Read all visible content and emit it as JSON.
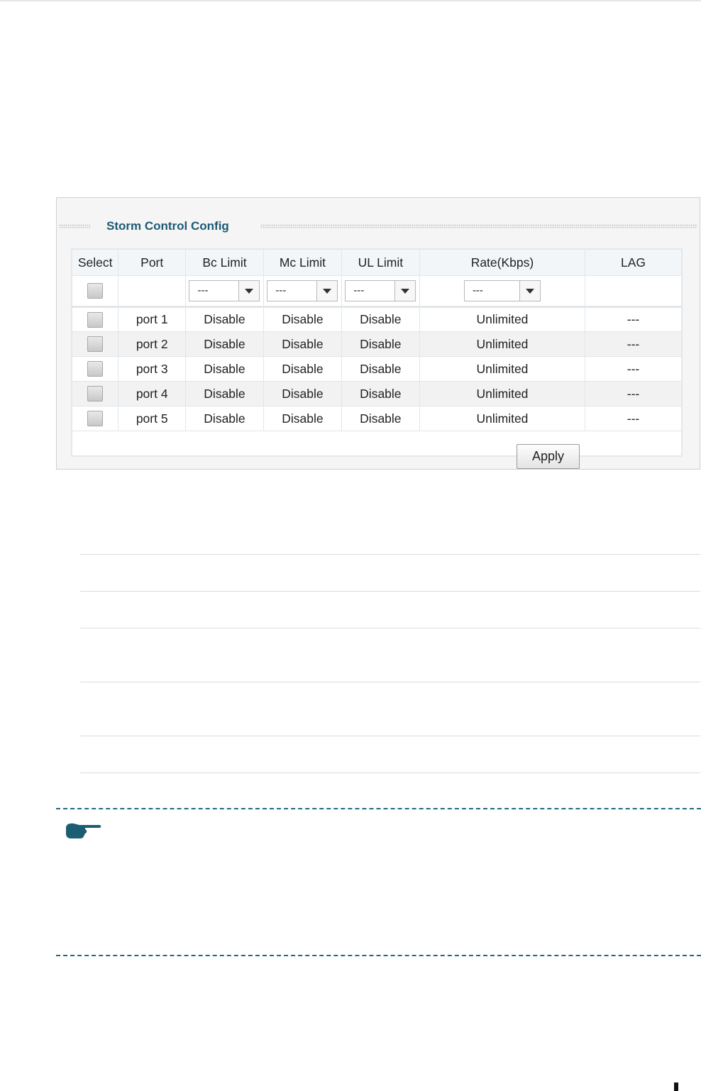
{
  "panel": {
    "title": "Storm Control Config",
    "apply_label": "Apply"
  },
  "table": {
    "headers": [
      "Select",
      "Port",
      "Bc Limit",
      "Mc Limit",
      "UL Limit",
      "Rate(Kbps)",
      "LAG"
    ],
    "filter": {
      "bc": "---",
      "mc": "---",
      "ul": "---",
      "rate": "---"
    },
    "rows": [
      {
        "port": "port 1",
        "bc": "Disable",
        "mc": "Disable",
        "ul": "Disable",
        "rate": "Unlimited",
        "lag": "---"
      },
      {
        "port": "port 2",
        "bc": "Disable",
        "mc": "Disable",
        "ul": "Disable",
        "rate": "Unlimited",
        "lag": "---"
      },
      {
        "port": "port 3",
        "bc": "Disable",
        "mc": "Disable",
        "ul": "Disable",
        "rate": "Unlimited",
        "lag": "---"
      },
      {
        "port": "port 4",
        "bc": "Disable",
        "mc": "Disable",
        "ul": "Disable",
        "rate": "Unlimited",
        "lag": "---"
      },
      {
        "port": "port 5",
        "bc": "Disable",
        "mc": "Disable",
        "ul": "Disable",
        "rate": "Unlimited",
        "lag": "---"
      }
    ]
  },
  "icons": {
    "note": "pointing-hand-icon"
  },
  "colors": {
    "title": "#1d5a73",
    "dash": "#1f6a83"
  }
}
